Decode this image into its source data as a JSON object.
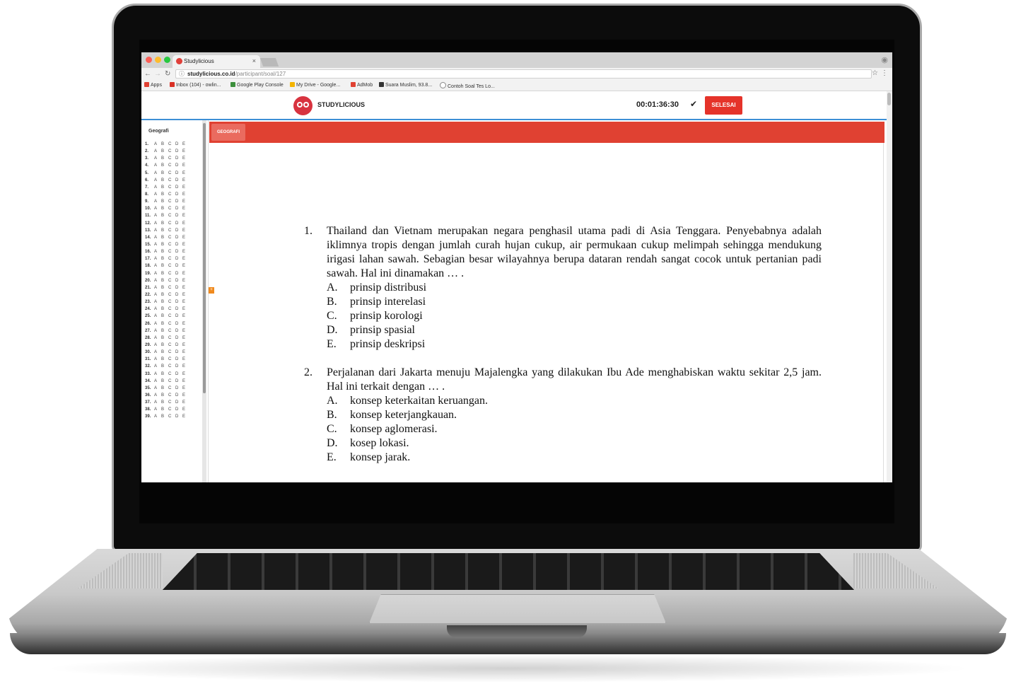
{
  "browser": {
    "tab_title": "Studylicious",
    "tab_close": "×",
    "url_host": "studylicious.co.id",
    "url_path": "/participant/soal/127",
    "bookmarks": [
      {
        "label": "Apps",
        "color": "#e04132"
      },
      {
        "label": "Inbox (104) - owlin...",
        "color": "#d93025"
      },
      {
        "label": "Google Play Console",
        "color": "#3c8f3c"
      },
      {
        "label": "My Drive - Google...",
        "color": "#f4b400"
      },
      {
        "label": "AdMob",
        "color": "#e04132"
      },
      {
        "label": "Suara Muslim, 93.8...",
        "color": "#333333"
      },
      {
        "label": "Contoh Soal Tes Lo...",
        "color": "#888888"
      }
    ]
  },
  "app": {
    "brand": "STUDYLICIOUS",
    "timer": "00:01:36:30",
    "finish_label": "SELESAI",
    "accent_color": "#e04132"
  },
  "sidebar": {
    "title": "Geografi",
    "options": [
      "A",
      "B",
      "C",
      "D",
      "E"
    ],
    "question_count": 39
  },
  "subject_tab": "GEOGRAFI",
  "questions": [
    {
      "number": "1.",
      "text": "Thailand dan Vietnam merupakan negara penghasil utama padi di Asia Tenggara. Penyebabnya adalah iklimnya tropis dengan jumlah curah hujan cukup, air permukaan cukup melimpah sehingga mendukung irigasi lahan sawah. Sebagian besar wilayahnya berupa dataran rendah sangat cocok untuk pertanian padi sawah. Hal ini dinamakan … .",
      "options": [
        {
          "letter": "A.",
          "text": "prinsip distribusi"
        },
        {
          "letter": "B.",
          "text": "prinsip interelasi"
        },
        {
          "letter": "C.",
          "text": "prinsip korologi"
        },
        {
          "letter": "D.",
          "text": "prinsip spasial"
        },
        {
          "letter": "E.",
          "text": "prinsip deskripsi"
        }
      ]
    },
    {
      "number": "2.",
      "text": "Perjalanan dari Jakarta menuju Majalengka yang dilakukan Ibu Ade menghabiskan waktu sekitar 2,5 jam. Hal ini terkait dengan … .",
      "options": [
        {
          "letter": "A.",
          "text": "konsep keterkaitan keruangan."
        },
        {
          "letter": "B.",
          "text": "konsep keterjangkauan."
        },
        {
          "letter": "C.",
          "text": "konsep aglomerasi."
        },
        {
          "letter": "D.",
          "text": "kosep lokasi."
        },
        {
          "letter": "E.",
          "text": "konsep jarak."
        }
      ]
    }
  ]
}
